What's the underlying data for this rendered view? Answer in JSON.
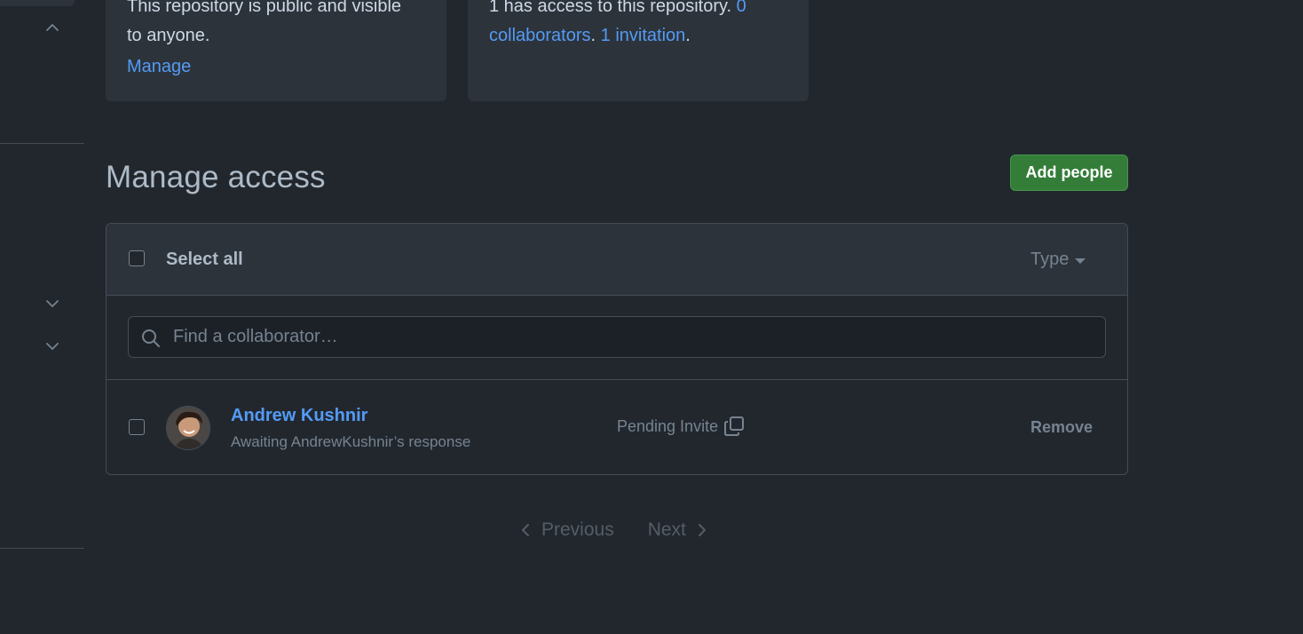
{
  "cards": {
    "visibility_text_top": "This repository is public and visible",
    "visibility_text_bottom": "to anyone.",
    "manage_link": "Manage",
    "access_prefix": "1 has access to this repository.",
    "access_count": "0",
    "collaborators_link": "collaborators",
    "invitation_link": "1 invitation",
    "separator": ".",
    "end": "."
  },
  "page": {
    "title": "Manage access",
    "add_button": "Add people"
  },
  "list": {
    "select_all": "Select all",
    "type_filter": "Type",
    "search_placeholder": "Find a collaborator…",
    "members": [
      {
        "name": "Andrew Kushnir",
        "status": "Awaiting AndrewKushnir’s response",
        "invite_state": "Pending Invite",
        "remove": "Remove"
      }
    ]
  },
  "pagination": {
    "previous": "Previous",
    "next": "Next"
  },
  "colors": {
    "background": "#22272e",
    "card": "#2d333b",
    "link": "#539bf5",
    "primary_button": "#347d39"
  }
}
